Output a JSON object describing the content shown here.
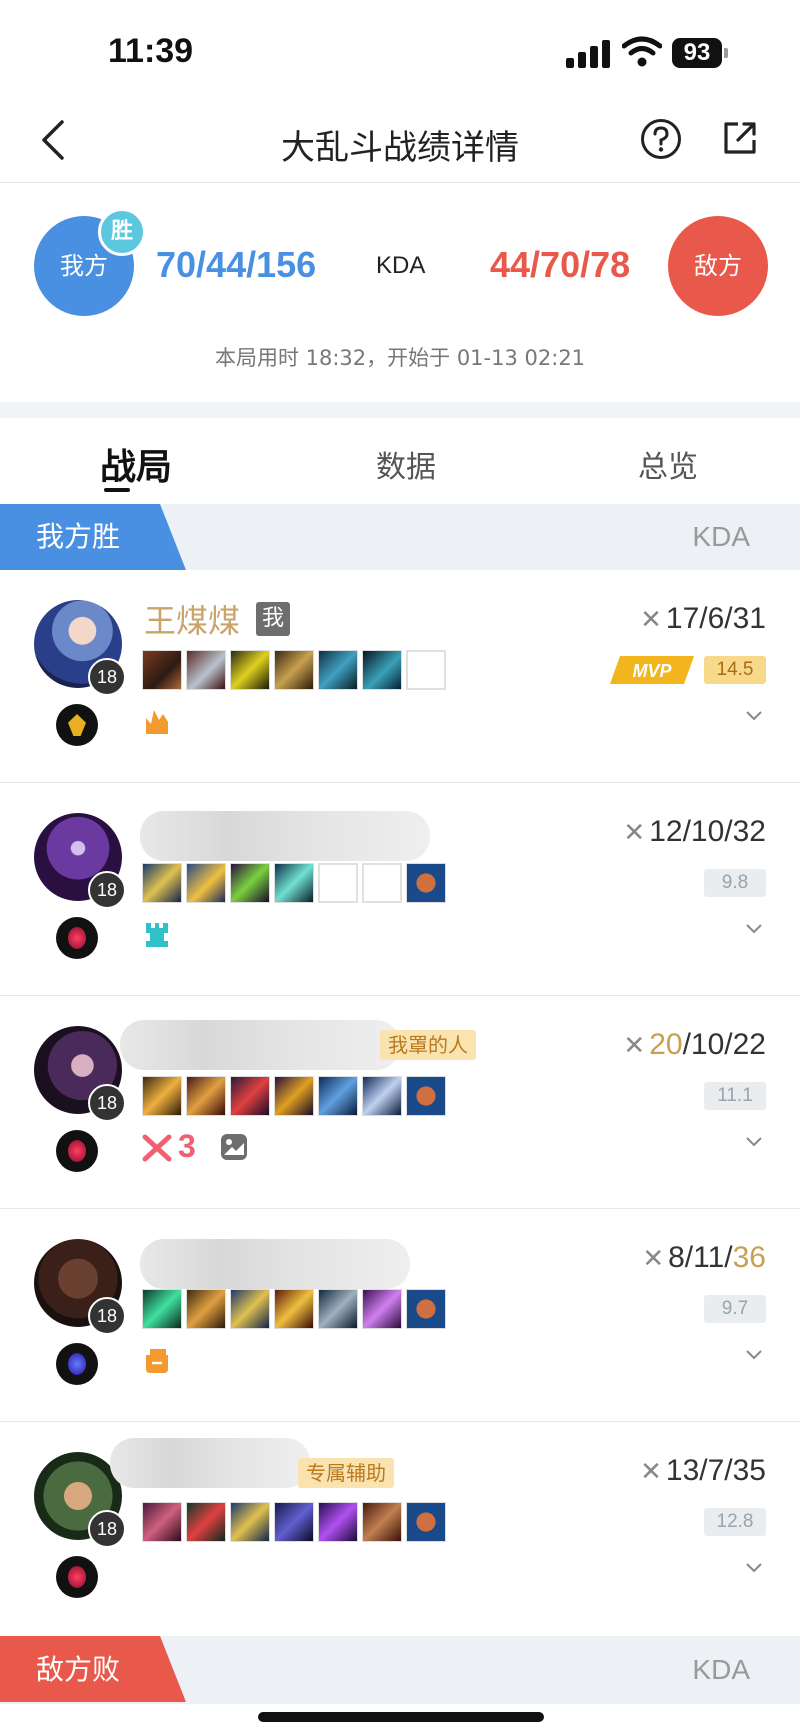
{
  "status_bar": {
    "time": "11:39",
    "battery": "93"
  },
  "nav": {
    "title": "大乱斗战绩详情"
  },
  "score": {
    "our_label": "我方",
    "win_badge": "胜",
    "our_kda": "70/44/156",
    "kda_label": "KDA",
    "enemy_kda": "44/70/78",
    "enemy_label": "敌方",
    "duration": "本局用时 18:32，开始于 01-13 02:21"
  },
  "tabs": [
    {
      "label": "战局",
      "active": true
    },
    {
      "label": "数据",
      "active": false
    },
    {
      "label": "总览",
      "active": false
    }
  ],
  "our_section": {
    "label": "我方胜",
    "kda": "KDA",
    "color": "#4a90e2"
  },
  "enemy_section": {
    "label": "敌方败",
    "kda": "KDA",
    "color": "#e8584b"
  },
  "players": [
    {
      "name": "王煤煤",
      "me_tag": "我",
      "level": "18",
      "kda_k": "17",
      "kda_rest": "/6/31",
      "rating": "14.5",
      "mvp": "MVP",
      "badge": "fire-icon"
    },
    {
      "name": "",
      "level": "18",
      "kda_k": "12",
      "kda_rest": "/10/32",
      "rating": "9.8",
      "badge": "tower-icon"
    },
    {
      "name": "",
      "title_tag": "我罩的人",
      "level": "18",
      "kda_k": "20",
      "kda_rest": "/10/22",
      "rating": "11.1",
      "badge": "triple-kill-icon",
      "badge_text": "3"
    },
    {
      "name": "",
      "level": "18",
      "kda_pre": "8/11/",
      "kda_a": "36",
      "rating": "9.7",
      "badge": "fist-icon"
    },
    {
      "name": "",
      "title_tag": "专属辅助",
      "level": "18",
      "kda_k": "13",
      "kda_rest": "/7/35",
      "rating": "12.8"
    }
  ]
}
